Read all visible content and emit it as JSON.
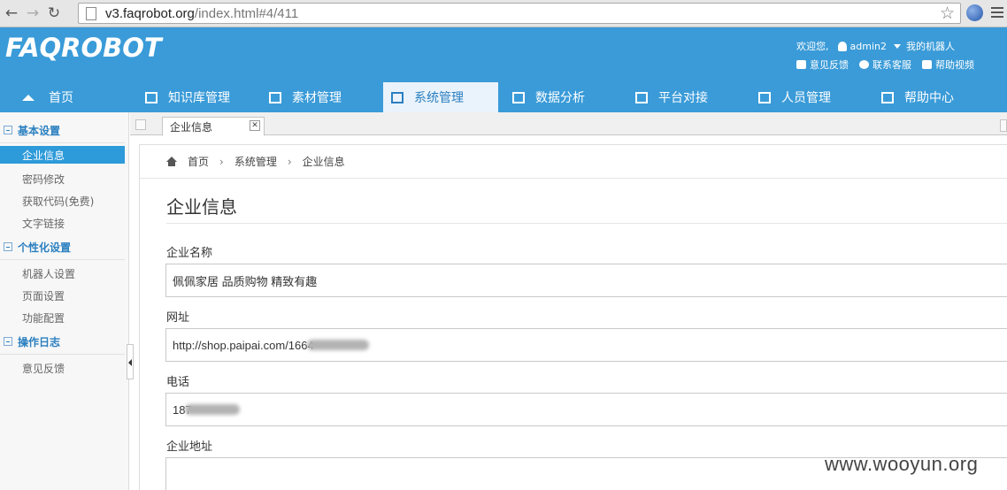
{
  "browser": {
    "url_host": "v3.faqrobot.org",
    "url_path": "/index.html#4/411"
  },
  "header": {
    "logo_text": "FAQROBOT",
    "welcome": "欢迎您,",
    "username": "admin2",
    "my_robot": "我的机器人",
    "feedback": "意见反馈",
    "contact": "联系客服",
    "help_video": "帮助视频"
  },
  "nav": {
    "items": [
      {
        "label": "首页",
        "icon": "home-icon"
      },
      {
        "label": "知识库管理",
        "icon": "knowledge-icon"
      },
      {
        "label": "素材管理",
        "icon": "material-icon"
      },
      {
        "label": "系统管理",
        "icon": "system-icon",
        "active": true
      },
      {
        "label": "数据分析",
        "icon": "analysis-icon"
      },
      {
        "label": "平台对接",
        "icon": "platform-icon"
      },
      {
        "label": "人员管理",
        "icon": "people-icon"
      },
      {
        "label": "帮助中心",
        "icon": "help-icon"
      }
    ]
  },
  "sidebar": {
    "groups": [
      {
        "title": "基本设置",
        "items": [
          "企业信息",
          "密码修改",
          "获取代码(免费)",
          "文字链接"
        ]
      },
      {
        "title": "个性化设置",
        "items": [
          "机器人设置",
          "页面设置",
          "功能配置"
        ]
      },
      {
        "title": "操作日志",
        "items": [
          "意见反馈"
        ]
      }
    ]
  },
  "tabs": {
    "active_label": "企业信息"
  },
  "breadcrumb": {
    "home": "首页",
    "level1": "系统管理",
    "level2": "企业信息"
  },
  "form": {
    "title": "企业信息",
    "company_name_label": "企业名称",
    "company_name_value": "佩佩家居  品质购物 精致有趣",
    "url_label": "网址",
    "url_value": "http://shop.paipai.com/1664",
    "phone_label": "电话",
    "phone_value": "187",
    "address_label": "企业地址",
    "address_value": ""
  },
  "watermark": "www.wooyun.org",
  "colors": {
    "header_bg": "#3a9bd8",
    "active_blue": "#2d9ad9",
    "group_title": "#2a7fc0"
  }
}
